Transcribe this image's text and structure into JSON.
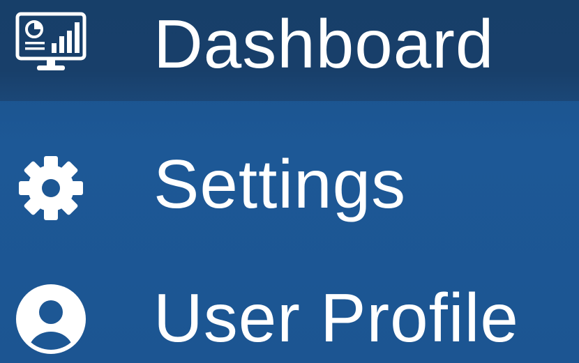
{
  "nav": {
    "items": [
      {
        "label": "Dashboard",
        "icon": "dashboard-monitor-icon",
        "active": true
      },
      {
        "label": "Settings",
        "icon": "gear-icon",
        "active": false
      },
      {
        "label": "User Profile",
        "icon": "user-avatar-icon",
        "active": false
      }
    ]
  },
  "colors": {
    "background": "#1d5794",
    "active_background": "#173f69",
    "text": "#ffffff"
  }
}
